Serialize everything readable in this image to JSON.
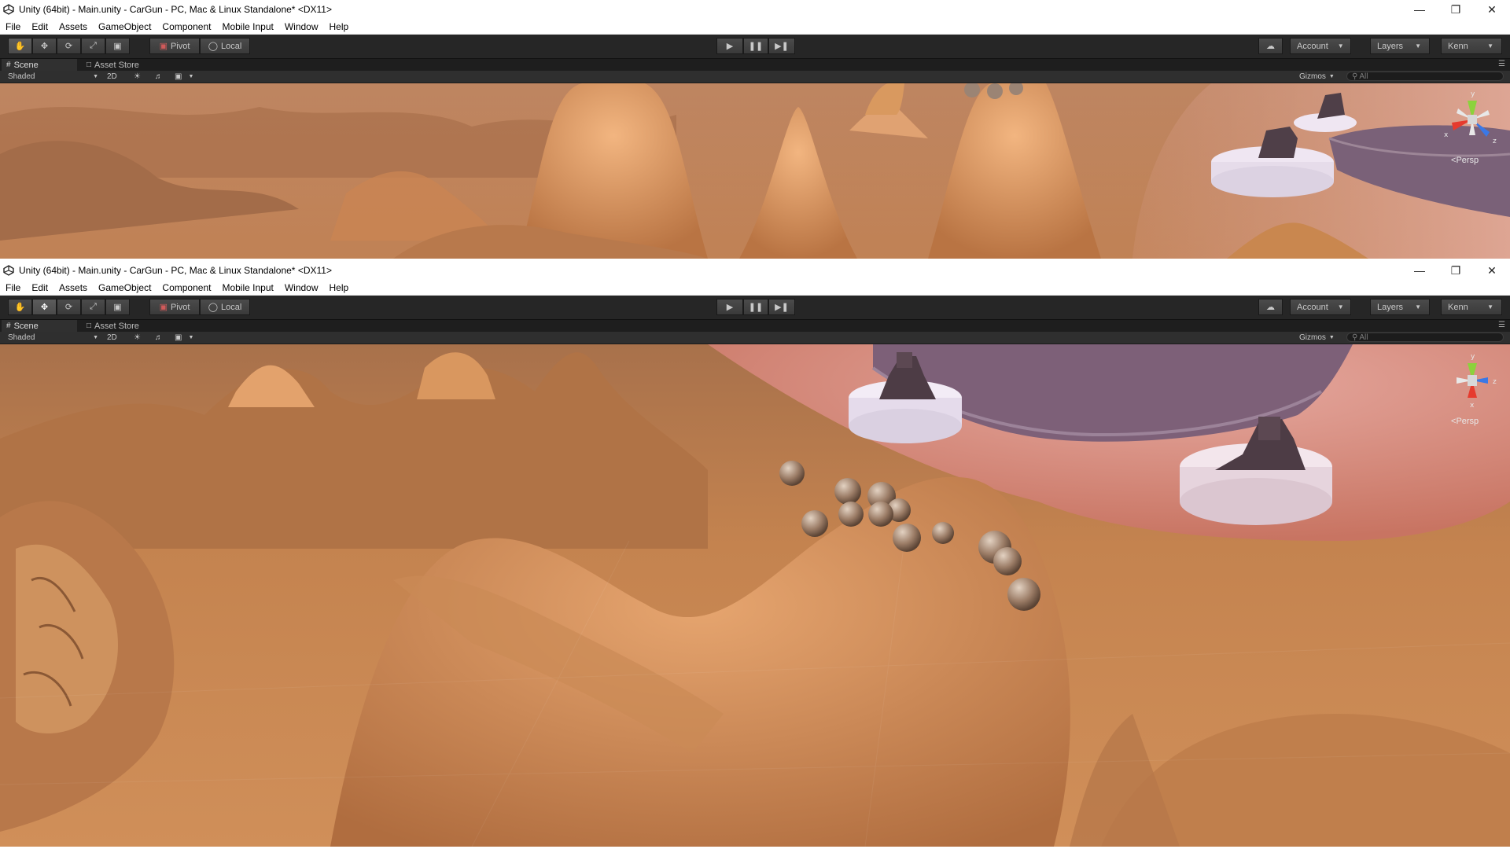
{
  "windows": [
    {
      "title": "Unity (64bit) - Main.unity - CarGun - PC, Mac & Linux Standalone* <DX11>",
      "menu": [
        "File",
        "Edit",
        "Assets",
        "GameObject",
        "Component",
        "Mobile Input",
        "Window",
        "Help"
      ],
      "toolbar": {
        "pivot": "Pivot",
        "local": "Local",
        "account": "Account",
        "layers": "Layers",
        "layout": "Kenn"
      },
      "tabs": {
        "scene": "Scene",
        "asset_store": "Asset Store"
      },
      "scene_bar": {
        "shading": "Shaded",
        "mode_2d": "2D",
        "gizmos": "Gizmos",
        "search_placeholder": "All"
      },
      "persp_label": "Persp",
      "axes": {
        "y": "y",
        "x": "x",
        "z": "z"
      },
      "active_tool": "hand"
    },
    {
      "title": "Unity (64bit) - Main.unity - CarGun - PC, Mac & Linux Standalone* <DX11>",
      "menu": [
        "File",
        "Edit",
        "Assets",
        "GameObject",
        "Component",
        "Mobile Input",
        "Window",
        "Help"
      ],
      "toolbar": {
        "pivot": "Pivot",
        "local": "Local",
        "account": "Account",
        "layers": "Layers",
        "layout": "Kenn"
      },
      "tabs": {
        "scene": "Scene",
        "asset_store": "Asset Store"
      },
      "scene_bar": {
        "shading": "Shaded",
        "mode_2d": "2D",
        "gizmos": "Gizmos",
        "search_placeholder": "All"
      },
      "persp_label": "Persp",
      "axes": {
        "y": "y",
        "x": "x",
        "z": "z"
      },
      "active_tool": "move"
    }
  ],
  "colors": {
    "terrain": "#c8864f",
    "terrain_light": "#f0b07a",
    "terrain_dark": "#8a5a35",
    "haze": "#c98a73",
    "toolbar": "#262626",
    "axis_x": "#e63b2e",
    "axis_y": "#8cd23c",
    "axis_z": "#3a78e6"
  }
}
